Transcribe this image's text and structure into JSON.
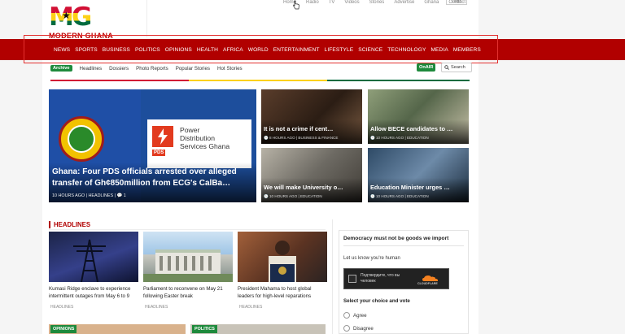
{
  "brand": {
    "logo_text": "MG",
    "name": "MODERN GHANA"
  },
  "topnav": {
    "items": [
      "Home",
      "Radio",
      "TV",
      "Videos",
      "Stories",
      "Advertise",
      "Ghana",
      "Contact"
    ],
    "login": "Login"
  },
  "mainnav": {
    "items": [
      "NEWS",
      "SPORTS",
      "BUSINESS",
      "POLITICS",
      "OPINIONS",
      "HEALTH",
      "AFRICA",
      "WORLD",
      "ENTERTAINMENT",
      "LIFESTYLE",
      "SCIENCE",
      "TECHNOLOGY",
      "MEDIA",
      "MEMBERS"
    ]
  },
  "subnav": {
    "archive": "Archive",
    "items": [
      "Headlines",
      "Dossiers",
      "Photo Reports",
      "Popular Stories",
      "Hot Stories"
    ],
    "onair": "OnAIR",
    "search": "Search"
  },
  "hero": {
    "pds_text_line1": "Power",
    "pds_text_line2": "Distribution",
    "pds_text_line3": "Services Ghana",
    "pds_logo": "PDS",
    "title": "Ghana: Four PDS officials arrested over alleged transfer of Gh¢850million from ECG's CalBa…",
    "meta": "10 HOURS AGO | HEADLINES | 💬 1"
  },
  "tiles": [
    {
      "title": "It is not a crime if cent…",
      "meta": "🕒 8 HOURS AGO  |  BUSINESS & FINANCE"
    },
    {
      "title": "Allow BECE candidates to …",
      "meta": "🕒 10 HOURS AGO  |  EDUCATION"
    },
    {
      "title": "We will make University o…",
      "meta": "🕒 10 HOURS AGO  |  EDUCATION"
    },
    {
      "title": "Education Minister urges …",
      "meta": "🕒 10 HOURS AGO  |  EDUCATION"
    }
  ],
  "headlines": {
    "section_title": "HEADLINES",
    "cards": [
      {
        "title": "Kumasi Ridge enclave to experience intermittent outages from May 6 to 9",
        "tag": "HEADLINES"
      },
      {
        "title": "Parliament to reconvene on May 21 following Easter break",
        "tag": "HEADLINES"
      },
      {
        "title": "President Mahama to host global leaders for high-level reparations",
        "tag": "HEADLINES"
      }
    ],
    "bottom_tags": [
      "OPINIONS",
      "POLITICS"
    ]
  },
  "widget": {
    "title": "Democracy must not be goods we import",
    "human_text": "Let us know you're human",
    "captcha_label": "Подтвердите, что вы человек",
    "captcha_brand": "CLOUDFLARE",
    "choice_title": "Select your choice and vote",
    "options": [
      "Agree",
      "Disagree"
    ]
  },
  "colors": {
    "brand_red": "#b10000",
    "green": "#1e8a3c"
  }
}
